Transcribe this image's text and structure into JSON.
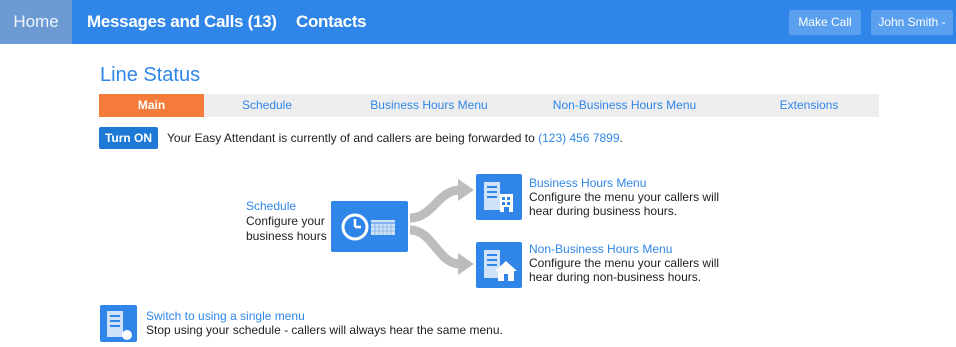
{
  "nav": {
    "home": "Home",
    "messages": "Messages and Calls (13)",
    "contacts": "Contacts",
    "make_call": "Make Call",
    "user": "John Smith -"
  },
  "page": {
    "title": "Line Status"
  },
  "tabs": [
    "Main",
    "Schedule",
    "Business Hours Menu",
    "Non-Business Hours Menu",
    "Extensions"
  ],
  "status": {
    "button": "Turn ON",
    "message": "Your Easy Attendant is currently of and callers are being forwarded to ",
    "phone": "(123) 456 7899",
    "end": "."
  },
  "schedule": {
    "link": "Schedule",
    "desc1": "Configure your",
    "desc2": "business hours"
  },
  "business_menu": {
    "link": "Business Hours Menu",
    "desc1": "Configure the menu your callers will",
    "desc2": "hear during business hours."
  },
  "nonbusiness_menu": {
    "link": "Non-Business Hours Menu",
    "desc1": "Configure the menu your callers will",
    "desc2": "hear during non-business hours."
  },
  "single_menu": {
    "link": "Switch to using a single menu",
    "desc": "Stop using your schedule - callers will always hear the same menu."
  },
  "colors": {
    "primary": "#2f86e8",
    "accent": "#f47b3a",
    "home_tab": "#6c9ad3"
  },
  "icons": [
    "clock-icon",
    "calendar-icon",
    "business-building-icon",
    "house-icon",
    "document-icon",
    "connector-arrows-icon"
  ]
}
